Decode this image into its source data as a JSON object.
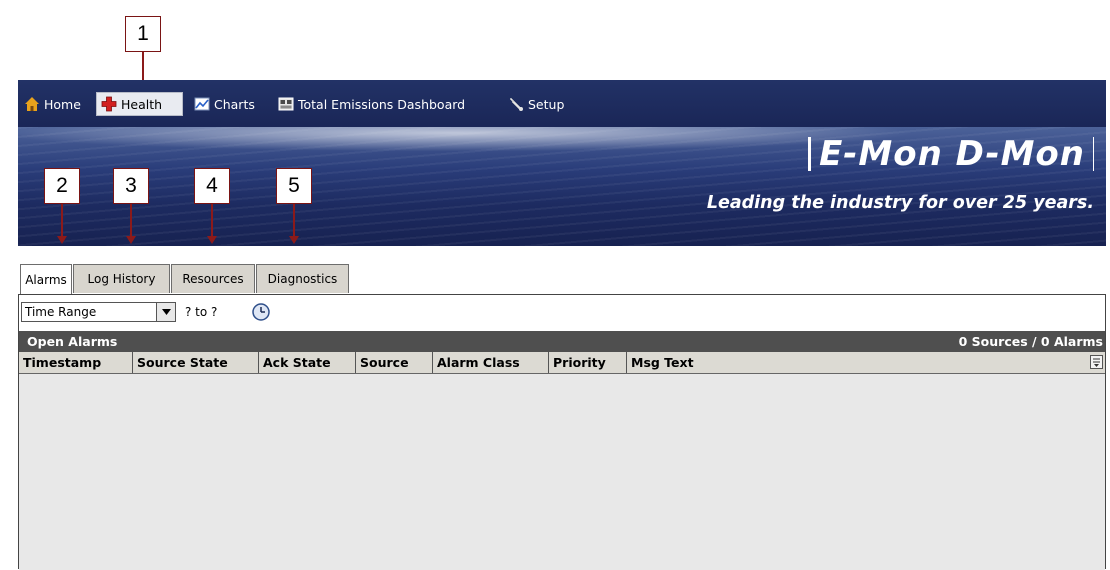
{
  "callouts": [
    "1",
    "2",
    "3",
    "4",
    "5"
  ],
  "nav": {
    "items": [
      {
        "label": "Home",
        "icon": "home-icon"
      },
      {
        "label": "Health",
        "icon": "health-cross-icon",
        "active": true
      },
      {
        "label": "Charts",
        "icon": "chart-icon"
      },
      {
        "label": "Total Emissions Dashboard",
        "icon": "dashboard-icon"
      },
      {
        "label": "Setup",
        "icon": "wrench-icon"
      }
    ]
  },
  "banner": {
    "logo": "E-Mon D-Mon",
    "tagline": "Leading the industry for over 25 years."
  },
  "tabs": [
    {
      "label": "Alarms",
      "active": true
    },
    {
      "label": "Log History"
    },
    {
      "label": "Resources"
    },
    {
      "label": "Diagnostics"
    }
  ],
  "toolbar": {
    "time_range": "Time Range",
    "range_text": "? to ?"
  },
  "grid": {
    "title": "Open Alarms",
    "count": "0 Sources / 0 Alarms",
    "columns": [
      "Timestamp",
      "Source State",
      "Ack State",
      "Source",
      "Alarm Class",
      "Priority",
      "Msg Text"
    ]
  },
  "colors": {
    "nav_bg": "#1f2d5e",
    "callout_border": "#7a1414",
    "grid_header_bg": "#4f4f4f",
    "tab_bg": "#d8d5ce",
    "body_bg": "#e8e8e8"
  }
}
